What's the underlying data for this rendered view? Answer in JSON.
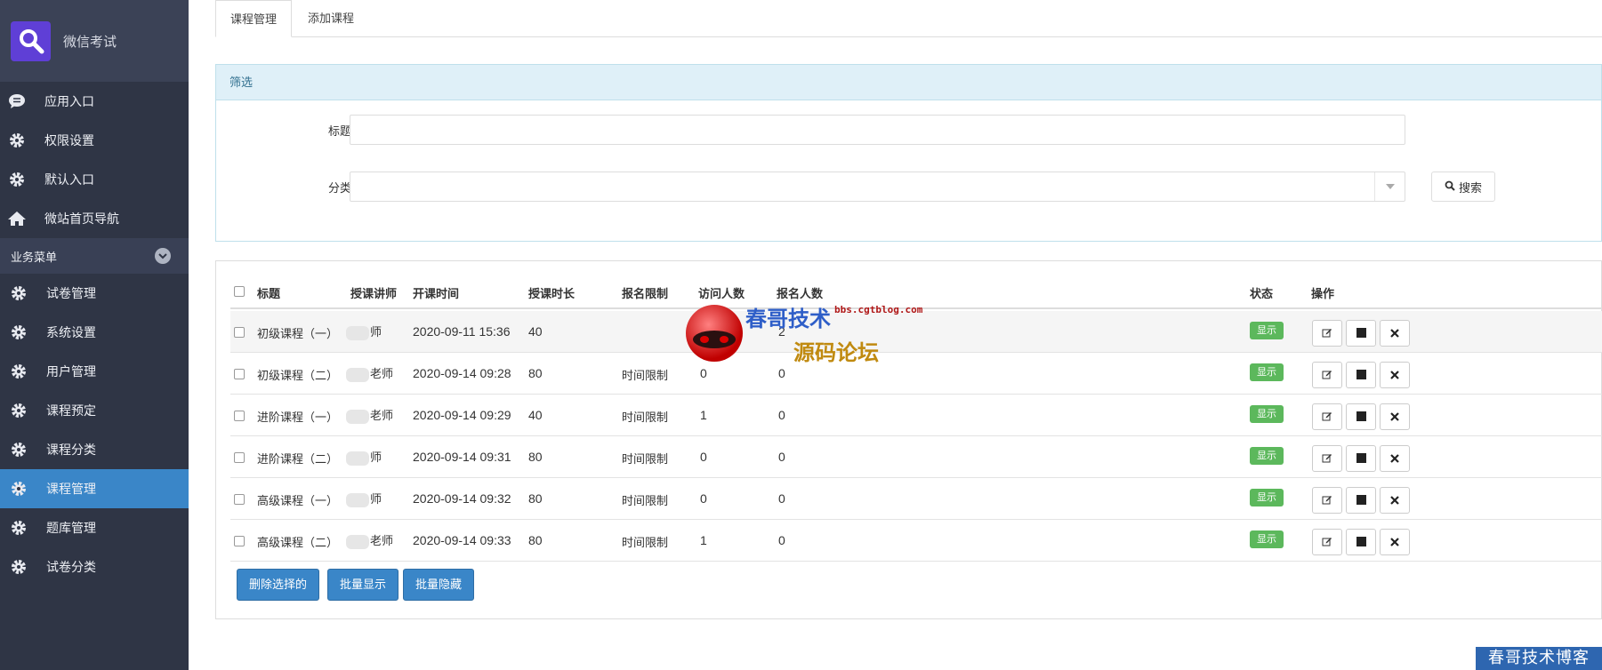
{
  "sidebar": {
    "brand_title": "微信考试",
    "top_items": [
      {
        "label": "应用入口",
        "icon": "comment-icon"
      },
      {
        "label": "权限设置",
        "icon": "gear-icon"
      },
      {
        "label": "默认入口",
        "icon": "gear-icon"
      },
      {
        "label": "微站首页导航",
        "icon": "home-icon"
      }
    ],
    "section_label": "业务菜单",
    "section_items": [
      {
        "label": "试卷管理",
        "icon": "gear-icon"
      },
      {
        "label": "系统设置",
        "icon": "gear-icon"
      },
      {
        "label": "用户管理",
        "icon": "gear-icon"
      },
      {
        "label": "课程预定",
        "icon": "gear-icon"
      },
      {
        "label": "课程分类",
        "icon": "gear-icon"
      },
      {
        "label": "课程管理",
        "icon": "gear-icon",
        "active": true
      },
      {
        "label": "题库管理",
        "icon": "gear-icon"
      },
      {
        "label": "试卷分类",
        "icon": "gear-icon"
      }
    ]
  },
  "tabs": [
    "课程管理",
    "添加课程"
  ],
  "filter": {
    "header": "筛选",
    "title_label": "标题",
    "title_value": "",
    "category_label": "分类",
    "category_value": "",
    "search_label": "搜索"
  },
  "table": {
    "headers": [
      "标题",
      "授课讲师",
      "开课时间",
      "授课时长",
      "报名限制",
      "访问人数",
      "报名人数",
      "状态",
      "操作"
    ],
    "rows": [
      {
        "title": "初级课程（一）",
        "teacher": "师",
        "start": "2020-09-11 15:36",
        "duration": "40",
        "limit": "",
        "visits": "",
        "signups": "2",
        "status": "显示"
      },
      {
        "title": "初级课程（二）",
        "teacher": "老师",
        "start": "2020-09-14 09:28",
        "duration": "80",
        "limit": "时间限制",
        "visits": "0",
        "signups": "0",
        "status": "显示"
      },
      {
        "title": "进阶课程（一）",
        "teacher": "老师",
        "start": "2020-09-14 09:29",
        "duration": "40",
        "limit": "时间限制",
        "visits": "1",
        "signups": "0",
        "status": "显示"
      },
      {
        "title": "进阶课程（二）",
        "teacher": "师",
        "start": "2020-09-14 09:31",
        "duration": "80",
        "limit": "时间限制",
        "visits": "0",
        "signups": "0",
        "status": "显示"
      },
      {
        "title": "高级课程（一）",
        "teacher": "师",
        "start": "2020-09-14 09:32",
        "duration": "80",
        "limit": "时间限制",
        "visits": "0",
        "signups": "0",
        "status": "显示"
      },
      {
        "title": "高级课程（二）",
        "teacher": "老师",
        "start": "2020-09-14 09:33",
        "duration": "80",
        "limit": "时间限制",
        "visits": "1",
        "signups": "0",
        "status": "显示"
      }
    ]
  },
  "bulk_actions": [
    "删除选择的",
    "批量显示",
    "批量隐藏"
  ],
  "watermark": {
    "url": "bbs.cgtblog.com",
    "line1": "春哥技术",
    "line2": "源码论坛",
    "corner": "春哥技术博客"
  },
  "colors": {
    "sidebar_bg": "#2f3545",
    "active_blue": "#3a86c8",
    "status_green": "#5cb85c",
    "brand_purple": "#5f3fd6"
  }
}
